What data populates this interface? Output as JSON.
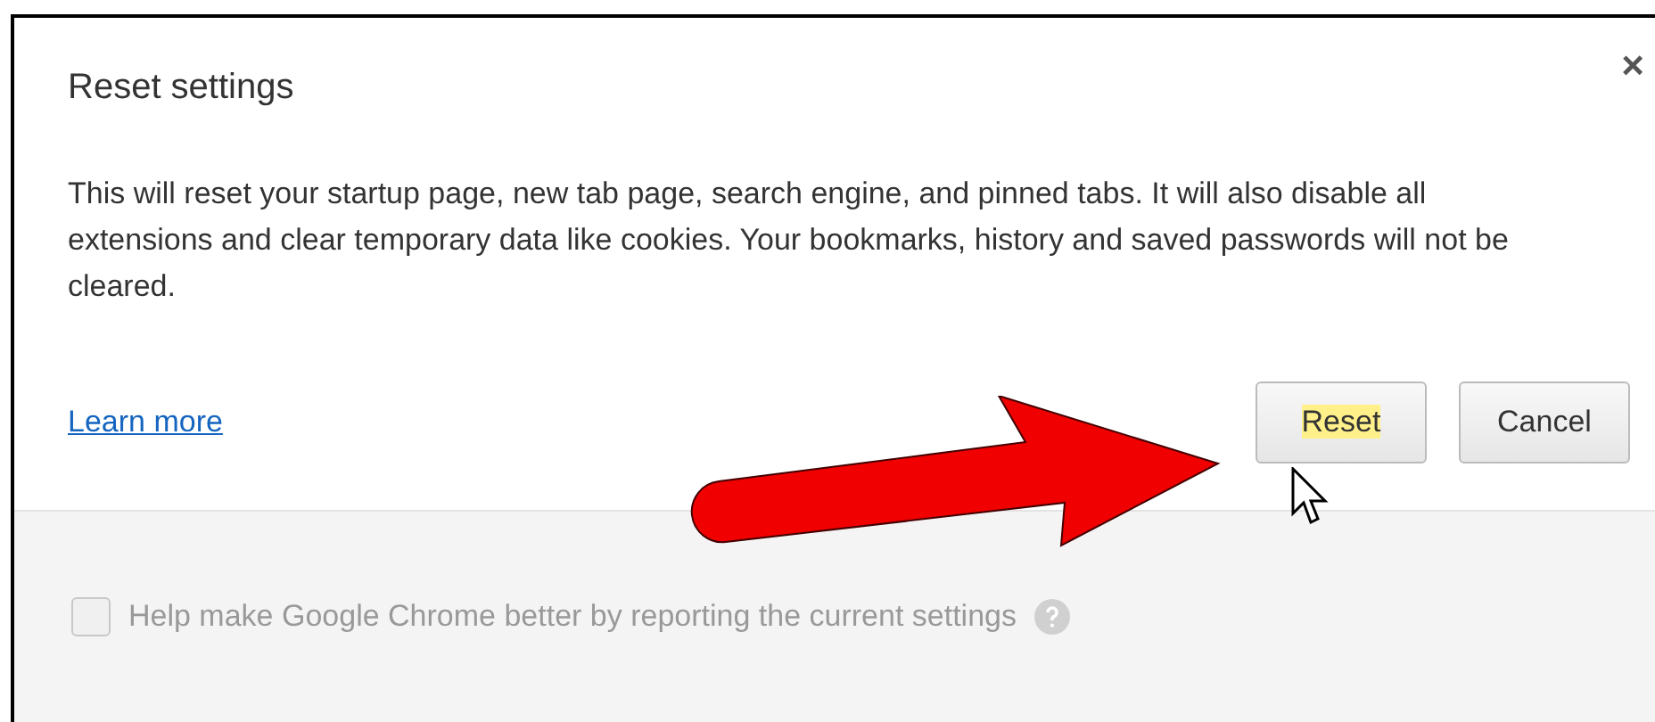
{
  "dialog": {
    "title": "Reset settings",
    "close": "×",
    "message": "This will reset your startup page, new tab page, search engine, and pinned tabs. It will also disable all extensions and clear temporary data like cookies. Your bookmarks, history and saved passwords will not be cleared.",
    "link": "Learn more",
    "buttons": [
      {
        "label": "Reset",
        "highlighted": true
      },
      {
        "label": "Cancel",
        "highlighted": false
      }
    ]
  },
  "footer": {
    "checkbox": {
      "label": "Help make Google Chrome better by reporting the current settings",
      "checked": false,
      "disabled": true
    }
  }
}
